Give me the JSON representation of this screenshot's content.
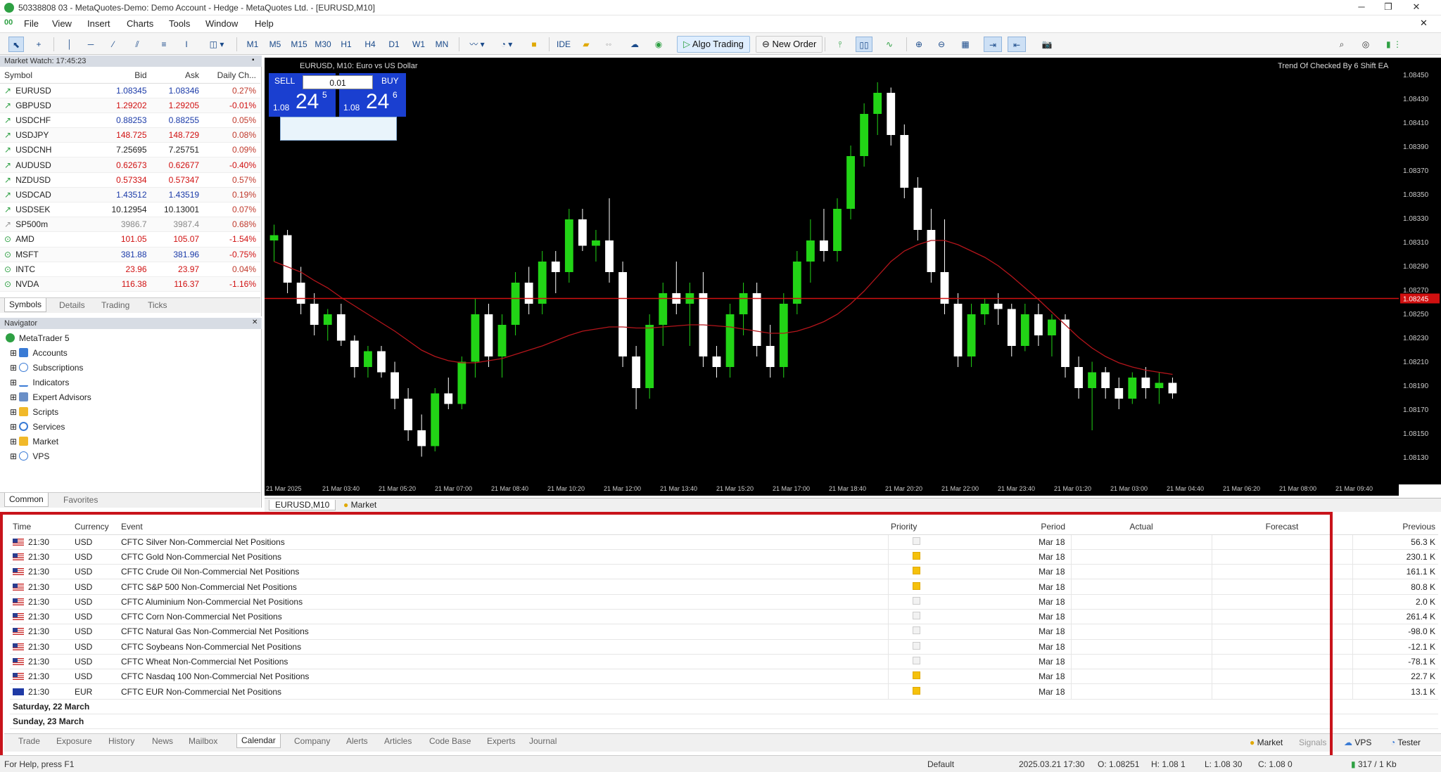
{
  "window": {
    "title": "50338808 03 - MetaQuotes-Demo: Demo Account - Hedge - MetaQuotes Ltd. - [EURUSD,M10]",
    "controls": [
      "─",
      "❐",
      "✕"
    ]
  },
  "menu": [
    "File",
    "View",
    "Insert",
    "Charts",
    "Tools",
    "Window",
    "Help"
  ],
  "toolbar": {
    "timeframes": [
      "M1",
      "M5",
      "M15",
      "M30",
      "H1",
      "H4",
      "D1",
      "W1",
      "MN"
    ],
    "algo_trading": "Algo Trading",
    "new_order": "New Order"
  },
  "market_watch": {
    "title": "Market Watch: 17:45:23",
    "columns": [
      "Symbol",
      "Bid",
      "Ask",
      "Daily Ch..."
    ],
    "rows": [
      {
        "symbol": "EURUSD",
        "bid": "1.08345",
        "ask": "1.08346",
        "change": "0.27%",
        "color": "blue"
      },
      {
        "symbol": "GBPUSD",
        "bid": "1.29202",
        "ask": "1.29205",
        "change": "-0.01%",
        "color": "red"
      },
      {
        "symbol": "USDCHF",
        "bid": "0.88253",
        "ask": "0.88255",
        "change": "0.05%",
        "color": "blue"
      },
      {
        "symbol": "USDJPY",
        "bid": "148.725",
        "ask": "148.729",
        "change": "0.08%",
        "color": "red"
      },
      {
        "symbol": "USDCNH",
        "bid": "7.25695",
        "ask": "7.25751",
        "change": "0.09%",
        "color": "default"
      },
      {
        "symbol": "AUDUSD",
        "bid": "0.62673",
        "ask": "0.62677",
        "change": "-0.40%",
        "color": "red"
      },
      {
        "symbol": "NZDUSD",
        "bid": "0.57334",
        "ask": "0.57347",
        "change": "0.57%",
        "color": "red"
      },
      {
        "symbol": "USDCAD",
        "bid": "1.43512",
        "ask": "1.43519",
        "change": "0.19%",
        "color": "blue"
      },
      {
        "symbol": "USDSEK",
        "bid": "10.12954",
        "ask": "10.13001",
        "change": "0.07%",
        "color": "default"
      },
      {
        "symbol": "SP500m",
        "bid": "3986.7",
        "ask": "3987.4",
        "change": "0.68%",
        "color": "grey"
      },
      {
        "symbol": "AMD",
        "bid": "101.05",
        "ask": "105.07",
        "change": "-1.54%",
        "color": "red"
      },
      {
        "symbol": "MSFT",
        "bid": "381.88",
        "ask": "381.96",
        "change": "-0.75%",
        "color": "blue"
      },
      {
        "symbol": "INTC",
        "bid": "23.96",
        "ask": "23.97",
        "change": "0.04%",
        "color": "red"
      },
      {
        "symbol": "NVDA",
        "bid": "116.38",
        "ask": "116.37",
        "change": "-1.16%",
        "color": "red"
      }
    ],
    "tabs": [
      "Symbols",
      "Details",
      "Trading",
      "Ticks"
    ]
  },
  "navigator": {
    "title": "Navigator",
    "items": [
      "MetaTrader 5",
      "Accounts",
      "Subscriptions",
      "Indicators",
      "Expert Advisors",
      "Scripts",
      "Services",
      "Market",
      "VPS"
    ],
    "tabs": [
      "Common",
      "Favorites"
    ]
  },
  "chart": {
    "symbol_label": "EURUSD, M10: Euro vs US Dollar",
    "ea_label": "Trend Of Checked By 6 Shift EA",
    "sell_label": "SELL",
    "buy_label": "BUY",
    "lot": "0.01",
    "sell_price_prefix": "1.08",
    "sell_price_big": "24",
    "sell_price_sup": "5",
    "buy_price_prefix": "1.08",
    "buy_price_big": "24",
    "buy_price_sup": "6",
    "tab_label": "EURUSD,M10",
    "market_tab": "Market",
    "time_labels": [
      "21 Mar 2025",
      "21 Mar 03:40",
      "21 Mar 05:20",
      "21 Mar 07:00",
      "21 Mar 08:40",
      "21 Mar 10:20",
      "21 Mar 12:00",
      "21 Mar 13:40",
      "21 Mar 15:20",
      "21 Mar 17:00",
      "21 Mar 18:40",
      "21 Mar 20:20",
      "21 Mar 22:00",
      "21 Mar 23:40",
      "21 Mar 01:20",
      "21 Mar 03:00",
      "21 Mar 04:40",
      "21 Mar 06:20",
      "21 Mar 08:00",
      "21 Mar 09:40"
    ],
    "price_labels": [
      "1.08450",
      "1.08430",
      "1.08410",
      "1.08390",
      "1.08370",
      "1.08350",
      "1.08330",
      "1.08310",
      "1.08290",
      "1.08270",
      "1.08250",
      "1.08230",
      "1.08210",
      "1.08190",
      "1.08170",
      "1.08150",
      "1.08130"
    ],
    "current_price": "1.08245"
  },
  "chart_data": {
    "type": "candlestick",
    "series": [
      {
        "name": "EURUSD,M10",
        "candles": [
          [
            1.083,
            1.08315,
            1.0828,
            1.08305
          ],
          [
            1.08305,
            1.0831,
            1.0825,
            1.0826
          ],
          [
            1.0826,
            1.08275,
            1.0823,
            1.0824
          ],
          [
            1.0824,
            1.0825,
            1.0821,
            1.0822
          ],
          [
            1.0822,
            1.08235,
            1.08205,
            1.0823
          ],
          [
            1.0823,
            1.0824,
            1.082,
            1.08205
          ],
          [
            1.08205,
            1.0821,
            1.0817,
            1.0818
          ],
          [
            1.0818,
            1.082,
            1.0817,
            1.08195
          ],
          [
            1.08195,
            1.082,
            1.0817,
            1.08175
          ],
          [
            1.08175,
            1.08185,
            1.0814,
            1.0815
          ],
          [
            1.0815,
            1.0816,
            1.0811,
            1.0812
          ],
          [
            1.0812,
            1.08135,
            1.08095,
            1.08105
          ],
          [
            1.08105,
            1.0816,
            1.081,
            1.08155
          ],
          [
            1.08155,
            1.0817,
            1.0814,
            1.08145
          ],
          [
            1.08145,
            1.0819,
            1.0814,
            1.08185
          ],
          [
            1.08185,
            1.08245,
            1.0817,
            1.0823
          ],
          [
            1.0823,
            1.0824,
            1.0818,
            1.0819
          ],
          [
            1.0819,
            1.0823,
            1.0817,
            1.0822
          ],
          [
            1.0822,
            1.0827,
            1.0821,
            1.0826
          ],
          [
            1.0826,
            1.08275,
            1.0823,
            1.0824
          ],
          [
            1.0824,
            1.0829,
            1.0823,
            1.0828
          ],
          [
            1.0828,
            1.0829,
            1.0825,
            1.0827
          ],
          [
            1.0827,
            1.0833,
            1.0826,
            1.0832
          ],
          [
            1.0832,
            1.0833,
            1.0829,
            1.08295
          ],
          [
            1.08295,
            1.0831,
            1.0828,
            1.083
          ],
          [
            1.083,
            1.0834,
            1.0826,
            1.0827
          ],
          [
            1.0827,
            1.0828,
            1.0818,
            1.0819
          ],
          [
            1.0819,
            1.082,
            1.0814,
            1.0816
          ],
          [
            1.0816,
            1.0823,
            1.0815,
            1.0822
          ],
          [
            1.0822,
            1.0826,
            1.082,
            1.0825
          ],
          [
            1.0825,
            1.0828,
            1.0823,
            1.0824
          ],
          [
            1.0824,
            1.0826,
            1.082,
            1.0825
          ],
          [
            1.0825,
            1.0827,
            1.0818,
            1.0819
          ],
          [
            1.0819,
            1.082,
            1.0817,
            1.0818
          ],
          [
            1.0818,
            1.0824,
            1.0817,
            1.0823
          ],
          [
            1.0823,
            1.0826,
            1.0821,
            1.0825
          ],
          [
            1.0825,
            1.0826,
            1.0819,
            1.082
          ],
          [
            1.082,
            1.0822,
            1.0817,
            1.0818
          ],
          [
            1.0818,
            1.0825,
            1.0817,
            1.0824
          ],
          [
            1.0824,
            1.0829,
            1.0823,
            1.0828
          ],
          [
            1.0828,
            1.0832,
            1.0826,
            1.083
          ],
          [
            1.083,
            1.0833,
            1.0828,
            1.0829
          ],
          [
            1.0829,
            1.0834,
            1.0828,
            1.0833
          ],
          [
            1.0833,
            1.0839,
            1.0832,
            1.0838
          ],
          [
            1.0838,
            1.0843,
            1.0837,
            1.0842
          ],
          [
            1.0842,
            1.0845,
            1.084,
            1.0844
          ],
          [
            1.0844,
            1.08445,
            1.0839,
            1.084
          ],
          [
            1.084,
            1.0841,
            1.0834,
            1.0835
          ],
          [
            1.0835,
            1.0836,
            1.083,
            1.0831
          ],
          [
            1.0831,
            1.0833,
            1.0826,
            1.0827
          ],
          [
            1.0827,
            1.0832,
            1.0823,
            1.0824
          ],
          [
            1.0824,
            1.0825,
            1.0818,
            1.0819
          ],
          [
            1.0819,
            1.0824,
            1.0818,
            1.0823
          ],
          [
            1.0823,
            1.08245,
            1.0822,
            1.0824
          ],
          [
            1.0824,
            1.0825,
            1.0822,
            1.08235
          ],
          [
            1.08235,
            1.0824,
            1.0819,
            1.082
          ],
          [
            1.082,
            1.0824,
            1.08195,
            1.0823
          ],
          [
            1.0823,
            1.0824,
            1.082,
            1.0821
          ],
          [
            1.0821,
            1.0823,
            1.0819,
            1.08225
          ],
          [
            1.08225,
            1.0823,
            1.0817,
            1.0818
          ],
          [
            1.0818,
            1.0819,
            1.0815,
            1.0816
          ],
          [
            1.0816,
            1.08185,
            1.0812,
            1.08175
          ],
          [
            1.08175,
            1.0818,
            1.0815,
            1.0816
          ],
          [
            1.0816,
            1.0817,
            1.0814,
            1.0815
          ],
          [
            1.0815,
            1.08175,
            1.08145,
            1.0817
          ],
          [
            1.0817,
            1.0818,
            1.0815,
            1.0816
          ],
          [
            1.0816,
            1.08175,
            1.08145,
            1.08165
          ],
          [
            1.08165,
            1.0817,
            1.0815,
            1.08155
          ]
        ]
      },
      {
        "name": "MA",
        "values": [
          1.0828,
          1.08275,
          1.0827,
          1.08262,
          1.08255,
          1.08246,
          1.08238,
          1.0823,
          1.08222,
          1.08214,
          1.08205,
          1.08196,
          1.0819,
          1.08186,
          1.08184,
          1.08184,
          1.08186,
          1.08188,
          1.08192,
          1.08196,
          1.082,
          1.08205,
          1.0821,
          1.08214,
          1.08216,
          1.08218,
          1.08218,
          1.08217,
          1.08217,
          1.08218,
          1.08219,
          1.0822,
          1.0822,
          1.08219,
          1.08218,
          1.08216,
          1.08214,
          1.08212,
          1.08212,
          1.08214,
          1.08218,
          1.08223,
          1.0823,
          1.0824,
          1.08252,
          1.08266,
          1.0828,
          1.0829,
          1.08296,
          1.083,
          1.083,
          1.08296,
          1.0829,
          1.08284,
          1.08276,
          1.08266,
          1.08255,
          1.08244,
          1.08232,
          1.0822,
          1.08208,
          1.08198,
          1.0819,
          1.08184,
          1.0818,
          1.08177,
          1.08175,
          1.08173
        ]
      }
    ],
    "current_price": 1.08245,
    "ylim": [
      1.0808,
      1.0846
    ]
  },
  "calendar": {
    "columns": [
      "Time",
      "Currency",
      "Event",
      "Priority",
      "Period",
      "Actual",
      "Forecast",
      "Previous"
    ],
    "rows": [
      {
        "flag": "us",
        "time": "21:30",
        "currency": "USD",
        "event": "CFTC Silver Non-Commercial Net Positions",
        "priority": "low",
        "period": "Mar 18",
        "actual": "",
        "forecast": "",
        "previous": "56.3 K"
      },
      {
        "flag": "us",
        "time": "21:30",
        "currency": "USD",
        "event": "CFTC Gold Non-Commercial Net Positions",
        "priority": "medium",
        "period": "Mar 18",
        "actual": "",
        "forecast": "",
        "previous": "230.1 K"
      },
      {
        "flag": "us",
        "time": "21:30",
        "currency": "USD",
        "event": "CFTC Crude Oil Non-Commercial Net Positions",
        "priority": "medium",
        "period": "Mar 18",
        "actual": "",
        "forecast": "",
        "previous": "161.1 K"
      },
      {
        "flag": "us",
        "time": "21:30",
        "currency": "USD",
        "event": "CFTC S&P 500 Non-Commercial Net Positions",
        "priority": "medium",
        "period": "Mar 18",
        "actual": "",
        "forecast": "",
        "previous": "80.8 K"
      },
      {
        "flag": "us",
        "time": "21:30",
        "currency": "USD",
        "event": "CFTC Aluminium Non-Commercial Net Positions",
        "priority": "low",
        "period": "Mar 18",
        "actual": "",
        "forecast": "",
        "previous": "2.0 K"
      },
      {
        "flag": "us",
        "time": "21:30",
        "currency": "USD",
        "event": "CFTC Corn Non-Commercial Net Positions",
        "priority": "low",
        "period": "Mar 18",
        "actual": "",
        "forecast": "",
        "previous": "261.4 K"
      },
      {
        "flag": "us",
        "time": "21:30",
        "currency": "USD",
        "event": "CFTC Natural Gas Non-Commercial Net Positions",
        "priority": "low",
        "period": "Mar 18",
        "actual": "",
        "forecast": "",
        "previous": "-98.0 K"
      },
      {
        "flag": "us",
        "time": "21:30",
        "currency": "USD",
        "event": "CFTC Soybeans Non-Commercial Net Positions",
        "priority": "low",
        "period": "Mar 18",
        "actual": "",
        "forecast": "",
        "previous": "-12.1 K"
      },
      {
        "flag": "us",
        "time": "21:30",
        "currency": "USD",
        "event": "CFTC Wheat Non-Commercial Net Positions",
        "priority": "low",
        "period": "Mar 18",
        "actual": "",
        "forecast": "",
        "previous": "-78.1 K"
      },
      {
        "flag": "us",
        "time": "21:30",
        "currency": "USD",
        "event": "CFTC Nasdaq 100 Non-Commercial Net Positions",
        "priority": "medium",
        "period": "Mar 18",
        "actual": "",
        "forecast": "",
        "previous": "22.7 K"
      },
      {
        "flag": "eu",
        "time": "21:30",
        "currency": "EUR",
        "event": "CFTC EUR Non-Commercial Net Positions",
        "priority": "medium",
        "period": "Mar 18",
        "actual": "",
        "forecast": "",
        "previous": "13.1 K"
      }
    ],
    "sections": [
      "Saturday, 22 March",
      "Sunday, 23 March"
    ]
  },
  "bottom_tabs": [
    "Trade",
    "Exposure",
    "History",
    "News",
    "Mailbox",
    "Calendar",
    "Company",
    "Alerts",
    "Articles",
    "Code Base",
    "Experts",
    "Journal"
  ],
  "bottom_right": {
    "market": "Market",
    "signals": "Signals",
    "vps": "VPS",
    "tester": "Tester"
  },
  "statusbar": {
    "left": "For Help, press F1",
    "profile": "Default",
    "datetime": "2025.03.21 17:30",
    "o": "O: 1.08251",
    "h": "H: 1.08 1",
    "l": "L: 1.08 30",
    "c": "C: 1.08 0",
    "traffic": "317 / 1 Kb"
  },
  "colors": {
    "bull": "#22d416",
    "bear": "#ffffff",
    "ma": "#b4151b",
    "hline": "#d01010",
    "accent": "#c8131b"
  }
}
